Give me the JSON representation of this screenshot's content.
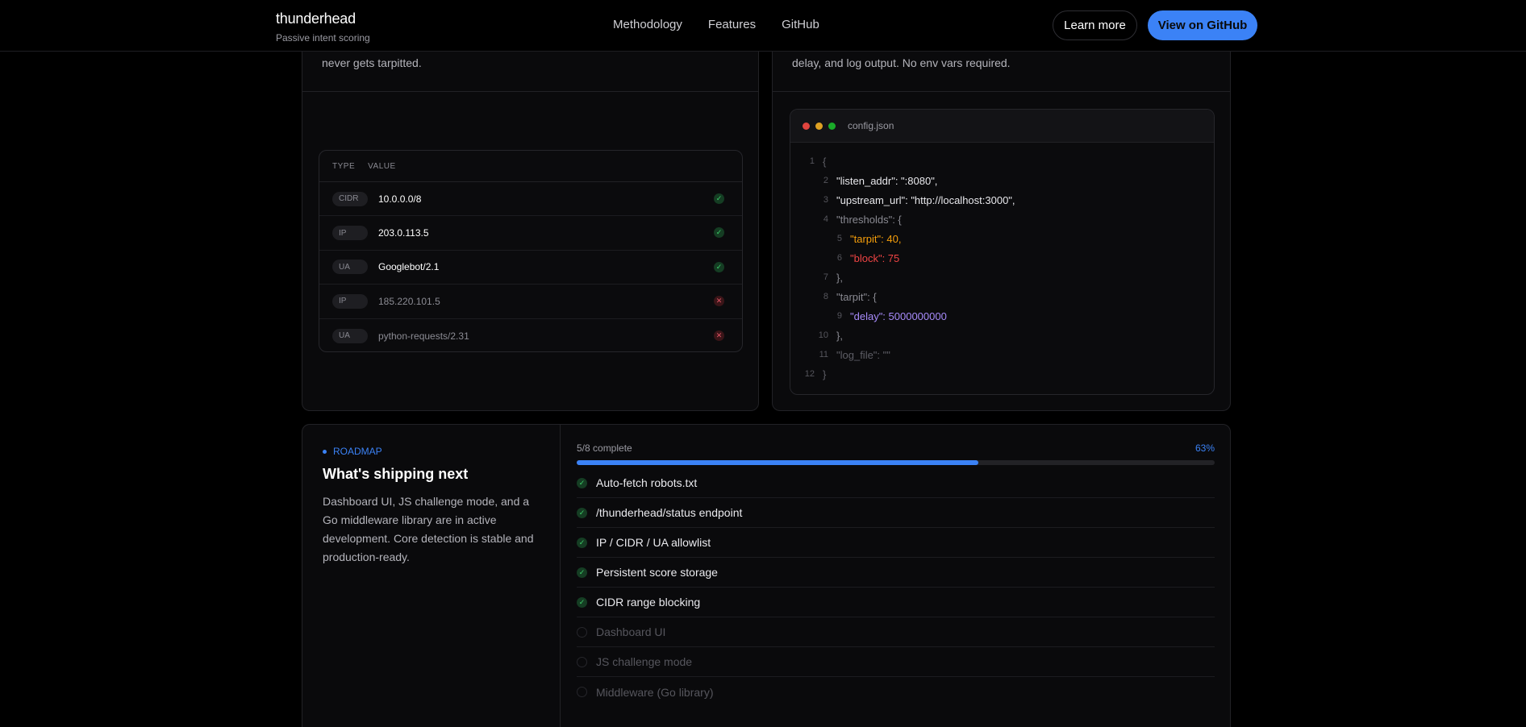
{
  "header": {
    "brand": "thunderhead",
    "tagline": "Passive intent scoring",
    "links": [
      "Methodology",
      "Features",
      "GitHub"
    ],
    "learn_more": "Learn more",
    "view_github": "View on GitHub"
  },
  "left_card": {
    "text": "never gets tarpitted.",
    "table": {
      "headers": [
        "TYPE",
        "VALUE"
      ],
      "rows": [
        {
          "type": "CIDR",
          "value": "10.0.0.0/8",
          "allowed": true
        },
        {
          "type": "IP",
          "value": "203.0.113.5",
          "allowed": true
        },
        {
          "type": "UA",
          "value": "Googlebot/2.1",
          "allowed": true
        },
        {
          "type": "IP",
          "value": "185.220.101.5",
          "allowed": false
        },
        {
          "type": "UA",
          "value": "python-requests/2.31",
          "allowed": false
        }
      ]
    }
  },
  "right_card": {
    "text": "delay, and log output. No env vars required.",
    "code": {
      "filename": "config.json",
      "lines": [
        {
          "n": "1",
          "text": "{"
        },
        {
          "n": "2",
          "text": "\"listen_addr\": \":8080\","
        },
        {
          "n": "3",
          "text": "\"upstream_url\": \"http://localhost:3000\","
        },
        {
          "n": "4",
          "text": "\"thresholds\": {"
        },
        {
          "n": "5",
          "text": "\"tarpit\": 40,"
        },
        {
          "n": "6",
          "text": "\"block\": 75"
        },
        {
          "n": "7",
          "text": "},"
        },
        {
          "n": "8",
          "text": "\"tarpit\": {"
        },
        {
          "n": "9",
          "text": "\"delay\": 5000000000"
        },
        {
          "n": "10",
          "text": "},"
        },
        {
          "n": "11",
          "text": "\"log_file\": \"\""
        },
        {
          "n": "12",
          "text": "}"
        }
      ]
    }
  },
  "roadmap": {
    "eyebrow": "ROADMAP",
    "title": "What's shipping next",
    "description": "Dashboard UI, JS challenge mode, and a Go middleware library are in active development. Core detection is stable and production-ready.",
    "progress_label": "5/8 complete",
    "progress_pct": "63%",
    "progress_value": 0.63,
    "items": [
      {
        "label": "Auto-fetch robots.txt",
        "done": true
      },
      {
        "label": "/thunderhead/status endpoint",
        "done": true
      },
      {
        "label": "IP / CIDR / UA allowlist",
        "done": true
      },
      {
        "label": "Persistent score storage",
        "done": true
      },
      {
        "label": "CIDR range blocking",
        "done": true
      },
      {
        "label": "Dashboard UI",
        "done": false
      },
      {
        "label": "JS challenge mode",
        "done": false
      },
      {
        "label": "Middleware (Go library)",
        "done": false
      }
    ]
  },
  "colors": {
    "accent": "#3b82f6",
    "ok": "#3ecf6a",
    "error": "#e05565",
    "window_red": "#e0443e",
    "window_yellow": "#dea123",
    "window_green": "#1aab29"
  }
}
